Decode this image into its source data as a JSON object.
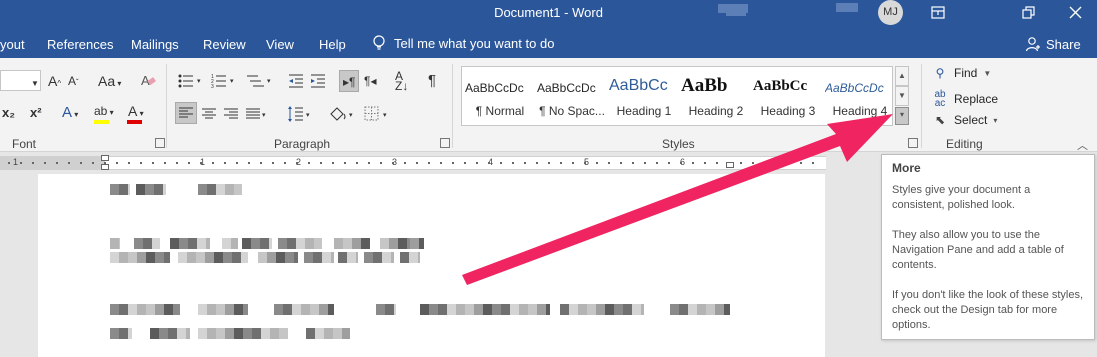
{
  "titlebar": {
    "title": "Document1  -  Word",
    "avatar_initials": "MJ",
    "icons": [
      "ribbon-display-icon",
      "restore-icon",
      "close-icon"
    ]
  },
  "tabs": {
    "items": [
      "yout",
      "References",
      "Mailings",
      "Review",
      "View",
      "Help"
    ],
    "tell_me": "Tell me what you want to do",
    "share": "Share"
  },
  "ribbon": {
    "groups": {
      "font": "Font",
      "paragraph": "Paragraph",
      "styles": "Styles",
      "editing": "Editing"
    },
    "font_glyphs": {
      "grow": "A",
      "shrink": "A",
      "case": "Aa",
      "subscript": "x₂",
      "superscript": "x²",
      "effects": "A",
      "highlight": "ab",
      "color": "A"
    },
    "paragraph_glyphs": {
      "pilcrow": "¶"
    },
    "styles": [
      {
        "preview": "AaBbCcDc",
        "name": "¶ Normal"
      },
      {
        "preview": "AaBbCcDc",
        "name": "¶ No Spac..."
      },
      {
        "preview": "AaBbCc",
        "name": "Heading 1"
      },
      {
        "preview": "AaBb",
        "name": "Heading 2"
      },
      {
        "preview": "AaBbCc",
        "name": "Heading 3"
      },
      {
        "preview": "AaBbCcDc",
        "name": "Heading 4"
      }
    ],
    "editing": {
      "find": "Find",
      "replace": "Replace",
      "select": "Select"
    }
  },
  "ruler": {
    "numbers": [
      "1",
      "1",
      "2",
      "3",
      "4",
      "5",
      "6"
    ]
  },
  "tooltip": {
    "title": "More",
    "paragraphs": [
      "Styles give your document a consistent, polished look.",
      "They also allow you to use the Navigation Pane and add a table of contents.",
      "If you don't like the look of these styles, check out the Design tab for more options."
    ]
  },
  "colors": {
    "title_bar": "#2b579a",
    "arrow": "#ef2461",
    "highlight_yellow": "#ffff00",
    "font_red": "#e00000",
    "heading_blue": "#2e5c99"
  }
}
